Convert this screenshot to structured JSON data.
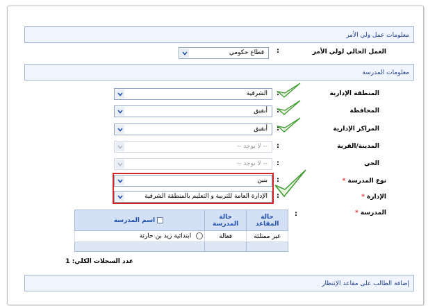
{
  "parent_work": {
    "section_title": "معلومات عمل ولي الأمر",
    "current_work_label": "العمل الحالي لولي الأمر",
    "current_work_value": "قطاع حكومي"
  },
  "school_info": {
    "section_title": "معلومات المدرسة",
    "fields": [
      {
        "label": "المنطقة الإدارية",
        "value": "الشرقية",
        "required": false
      },
      {
        "label": "المحافظة",
        "value": "أبقيق",
        "required": false
      },
      {
        "label": "المراكز الإدارية",
        "value": "أبقيق",
        "required": false
      },
      {
        "label": "المدينة/القرية",
        "value": "-- لا يوجد --",
        "required": false
      },
      {
        "label": "الحي",
        "value": "-- لا يوجد --",
        "required": false
      },
      {
        "label": "نوع المدرسة",
        "value": "بنين",
        "required": true,
        "required_mark": "*"
      },
      {
        "label": "الإدارة",
        "value": "الإدارة العامة للتربية و التعليم بالمنطقة الشرقية",
        "required": true,
        "required_mark": "*"
      }
    ],
    "school_label": "المدرسة",
    "school_required_mark": "*",
    "table": {
      "col_name": "اسم المدرسة",
      "col_status": "حالة المدرسة",
      "col_seats": "حالة المقاعد",
      "rows": [
        {
          "name": "ابتدائية زيد بن حارثة",
          "status": "فعالة",
          "seats": "غير ممتلئة"
        }
      ]
    },
    "records_total": "عدد السجلات الكلي: 1"
  },
  "waiting_section_title": "إضافة الطالب على مقاعد الإنتظار",
  "colon": ":"
}
